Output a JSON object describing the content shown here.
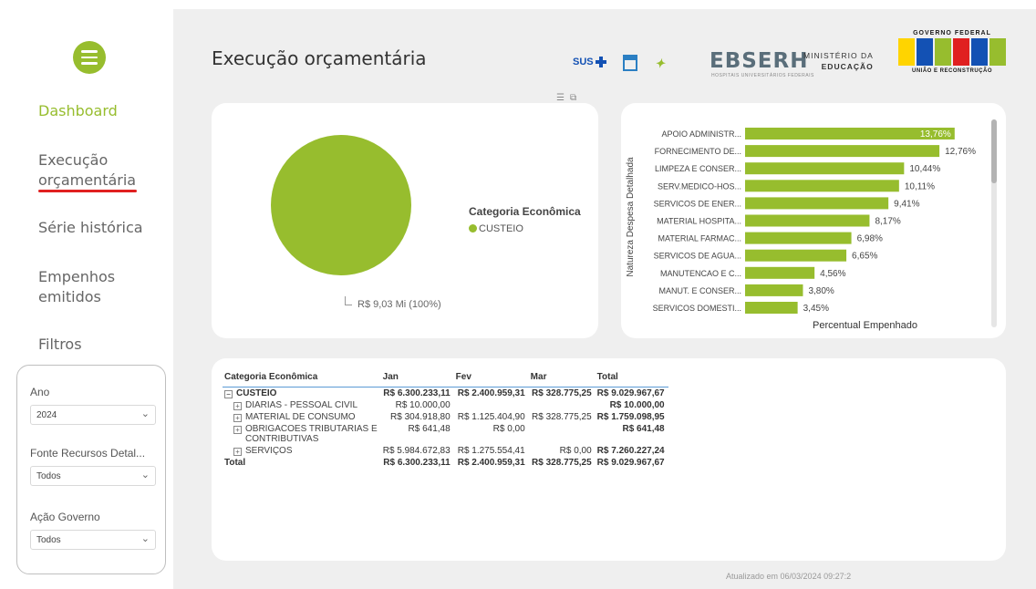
{
  "sidebar": {
    "nav": [
      "Dashboard",
      "Execução",
      "orçamentária",
      "Série histórica",
      "Empenhos",
      "emitidos",
      "Filtros"
    ],
    "filters": [
      {
        "label": "Ano",
        "value": "2024"
      },
      {
        "label": "Fonte Recursos Detal...",
        "value": "Todos"
      },
      {
        "label": "Ação Governo",
        "value": "Todos"
      }
    ]
  },
  "header": {
    "title": "Execução orçamentária",
    "logos": {
      "sus": "SUS",
      "ebserh": "EBSERH",
      "ebserh_sub": "HOSPITAIS UNIVERSITÁRIOS FEDERAIS",
      "mec_line1": "MINISTÉRIO DA",
      "mec_line2": "EDUCAÇÃO",
      "gov_top": "GOVERNO FEDERAL",
      "gov_bottom": "UNIÃO E RECONSTRUÇÃO"
    },
    "brand_colors": [
      "#ffd400",
      "#1351b4",
      "#97bd2e",
      "#e02020",
      "#1351b4",
      "#97bd2e"
    ]
  },
  "pie": {
    "legend_title": "Categoria Econômica",
    "legend_item": "CUSTEIO",
    "data_label": "R$ 9,03 Mi (100%)",
    "color": "#97bd2e"
  },
  "chart_data": {
    "type": "bar",
    "orientation": "horizontal",
    "ylabel": "Natureza Despesa Detalhada",
    "xlabel": "Percentual Empenhado",
    "categories": [
      "APOIO ADMINISTR...",
      "FORNECIMENTO DE...",
      "LIMPEZA E CONSER...",
      "SERV.MEDICO-HOS...",
      "SERVICOS DE ENER...",
      "MATERIAL HOSPITA...",
      "MATERIAL FARMAC...",
      "SERVICOS DE AGUA...",
      "MANUTENCAO E C...",
      "MANUT. E CONSER...",
      "SERVICOS DOMESTI..."
    ],
    "values": [
      13.76,
      12.76,
      10.44,
      10.11,
      9.41,
      8.17,
      6.98,
      6.65,
      4.56,
      3.8,
      3.45
    ],
    "labels": [
      "13,76%",
      "12,76%",
      "10,44%",
      "10,11%",
      "9,41%",
      "8,17%",
      "6,98%",
      "6,65%",
      "4,56%",
      "3,80%",
      "3,45%"
    ],
    "color": "#97bd2e"
  },
  "table": {
    "columns": [
      "Categoria Econômica",
      "Jan",
      "Fev",
      "Mar",
      "Total"
    ],
    "rows": [
      {
        "label": "CUSTEIO",
        "jan": "R$ 6.300.233,11",
        "fev": "R$ 2.400.959,31",
        "mar": "R$ 328.775,25",
        "total": "R$ 9.029.967,67"
      },
      {
        "label": "DIARIAS - PESSOAL CIVIL",
        "jan": "R$ 10.000,00",
        "fev": "",
        "mar": "",
        "total": "R$ 10.000,00"
      },
      {
        "label": "MATERIAL DE CONSUMO",
        "jan": "R$ 304.918,80",
        "fev": "R$ 1.125.404,90",
        "mar": "R$ 328.775,25",
        "total": "R$ 1.759.098,95"
      },
      {
        "label": "OBRIGACOES TRIBUTARIAS E",
        "label2": "CONTRIBUTIVAS",
        "jan": "R$ 641,48",
        "fev": "R$ 0,00",
        "mar": "",
        "total": "R$ 641,48"
      },
      {
        "label": "SERVIÇOS",
        "jan": "R$ 5.984.672,83",
        "fev": "R$ 1.275.554,41",
        "mar": "R$ 0,00",
        "total": "R$ 7.260.227,24"
      },
      {
        "label": "Total",
        "jan": "R$ 6.300.233,11",
        "fev": "R$ 2.400.959,31",
        "mar": "R$ 328.775,25",
        "total": "R$ 9.029.967,67"
      }
    ]
  },
  "footer": {
    "updated": "Atualizado em 06/03/2024 09:27:2"
  }
}
